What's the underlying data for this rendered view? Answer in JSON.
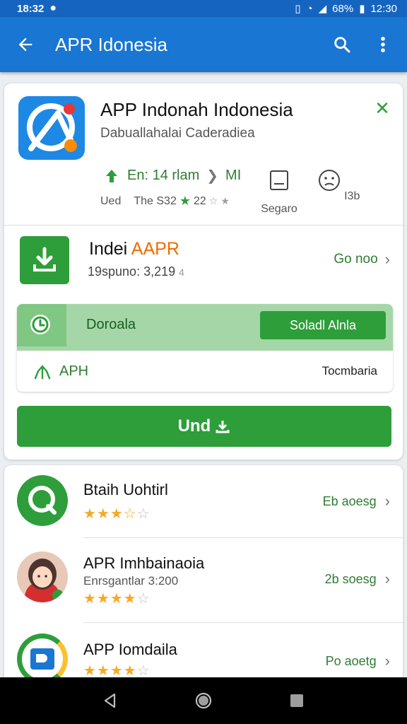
{
  "status_bar": {
    "time": "18:32",
    "battery": "68%",
    "clock_right": "12:30"
  },
  "app_bar": {
    "title": "APR Idonesia"
  },
  "app_header": {
    "name": "APP Indonah Indonesia",
    "developer": "Dabuallahalai Caderadiea",
    "size_text": "En: 14 rlam",
    "size_unit": "MI",
    "meta_prefix": "Ued",
    "meta_mid": "The S32",
    "meta_rating": "22",
    "stat_left_label": "Segaro",
    "stat_right_label": "I3b"
  },
  "download_row": {
    "title_prefix": "Indei",
    "title_accent": "AAPR",
    "subtitle": "19spuno: 3,219",
    "subtitle_suffix": "4",
    "link": "Go noo"
  },
  "promo": {
    "label": "Doroala",
    "button": "Soladl Alnla",
    "bottom_label": "APH",
    "bottom_right": "Tocmbaria"
  },
  "install_button": {
    "label": "Und"
  },
  "list": [
    {
      "name": "Btaih Uohtirl",
      "subtitle": "",
      "rating": 3.5,
      "link": "Eb aoesg"
    },
    {
      "name": "APR Imhbainaoia",
      "subtitle": "Enrsgantlar 3:200",
      "rating": 4,
      "link": "2b soesg"
    },
    {
      "name": "APP Iomdaila",
      "subtitle": "",
      "rating": 4,
      "link": "Po aoetg"
    }
  ],
  "colors": {
    "app_bar": "#1976d2",
    "status_bar": "#1565c0",
    "primary_green": "#2e9e3a",
    "accent_orange": "#ef6c00",
    "star": "#f9a825"
  }
}
